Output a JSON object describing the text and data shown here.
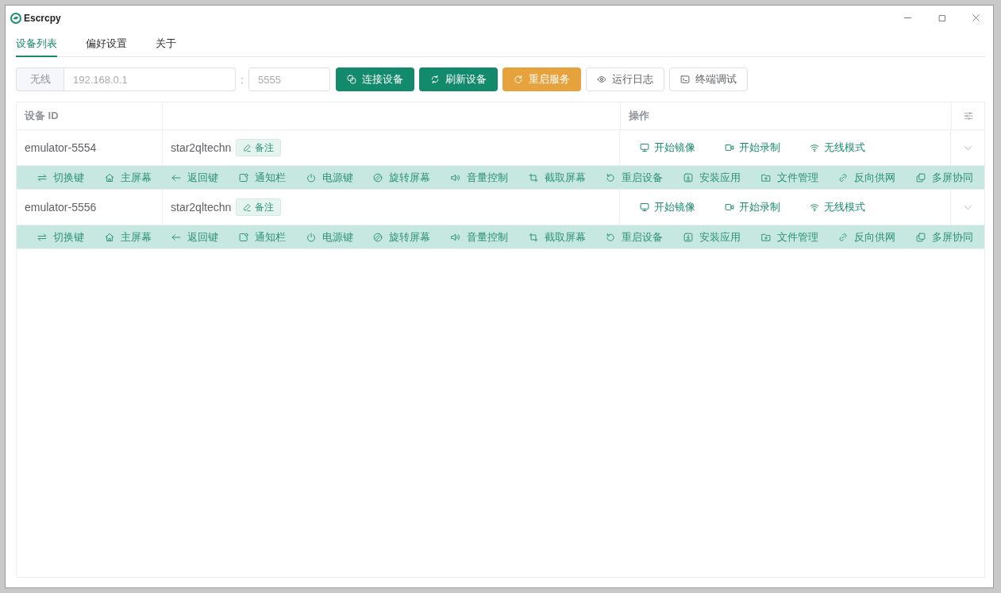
{
  "window": {
    "title": "Escrcpy"
  },
  "tabs": [
    {
      "label": "设备列表",
      "selected": true
    },
    {
      "label": "偏好设置",
      "selected": false
    },
    {
      "label": "关于",
      "selected": false
    }
  ],
  "connect_bar": {
    "prefix": "无线",
    "host_input": {
      "placeholder": "192.168.0.1"
    },
    "separator": ":",
    "port_input": {
      "placeholder": "5555"
    },
    "buttons": [
      {
        "label": "连接设备",
        "kind": "primary"
      },
      {
        "label": "刷新设备",
        "kind": "primary"
      },
      {
        "label": "重启服务",
        "kind": "warning"
      },
      {
        "label": "运行日志",
        "kind": "default"
      },
      {
        "label": "终端调试",
        "kind": "default"
      }
    ]
  },
  "table": {
    "columns": {
      "device_id": "设备 ID",
      "actions": "操作"
    },
    "rows": [
      {
        "device_id": "emulator-5554",
        "device_name": "star2qltechn",
        "note_button": "备注",
        "actions": [
          "开始镜像",
          "开始录制",
          "无线模式"
        ],
        "expanded": true,
        "controls": [
          "切换键",
          "主屏幕",
          "返回键",
          "通知栏",
          "电源键",
          "旋转屏幕",
          "音量控制",
          "截取屏幕",
          "重启设备",
          "安装应用",
          "文件管理",
          "反向供网",
          "多屏协同"
        ]
      },
      {
        "device_id": "emulator-5556",
        "device_name": "star2qltechn",
        "note_button": "备注",
        "actions": [
          "开始镜像",
          "开始录制",
          "无线模式"
        ],
        "expanded": true,
        "controls": [
          "切换键",
          "主屏幕",
          "返回键",
          "通知栏",
          "电源键",
          "旋转屏幕",
          "音量控制",
          "截取屏幕",
          "重启设备",
          "安装应用",
          "文件管理",
          "反向供网",
          "多屏协同"
        ]
      }
    ]
  }
}
